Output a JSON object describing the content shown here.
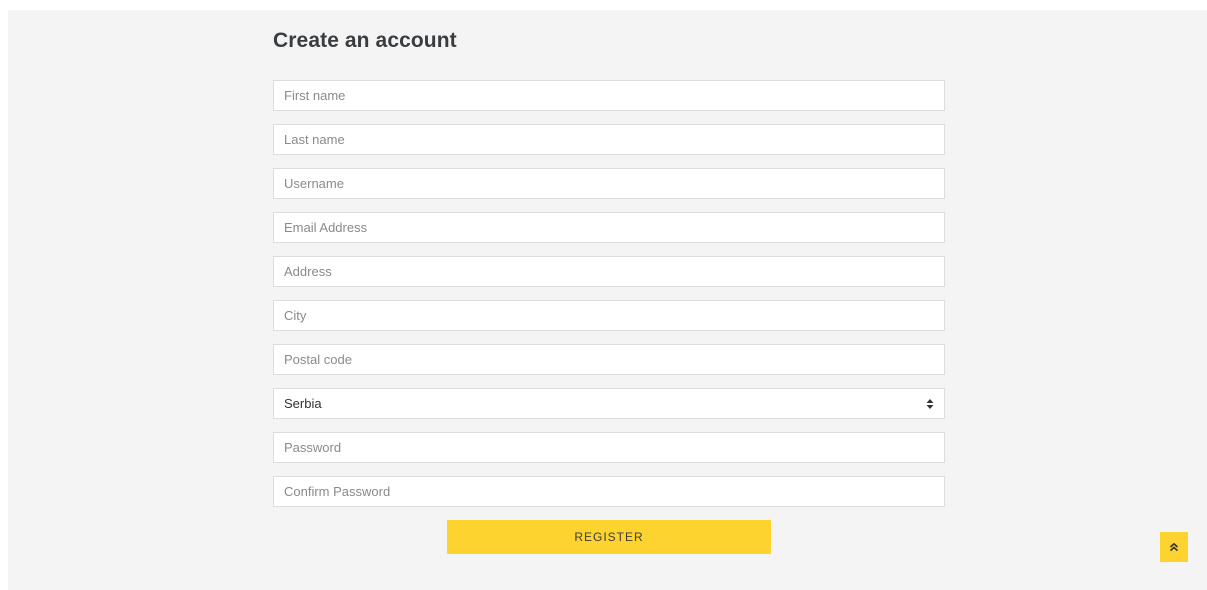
{
  "form": {
    "title": "Create an account",
    "fields": {
      "first_name": "First name",
      "last_name": "Last name",
      "username": "Username",
      "email": "Email Address",
      "address": "Address",
      "city": "City",
      "postal_code": "Postal code",
      "password": "Password",
      "confirm_password": "Confirm Password"
    },
    "country": {
      "selected": "Serbia"
    },
    "register_label": "REGISTER"
  },
  "colors": {
    "accent": "#fdd330",
    "panel_bg": "#f4f4f4",
    "border": "#dddddd",
    "title": "#3a3d40"
  },
  "icons": {
    "select_arrow": "sort-icon",
    "back_to_top": "chevron-double-up-icon"
  }
}
